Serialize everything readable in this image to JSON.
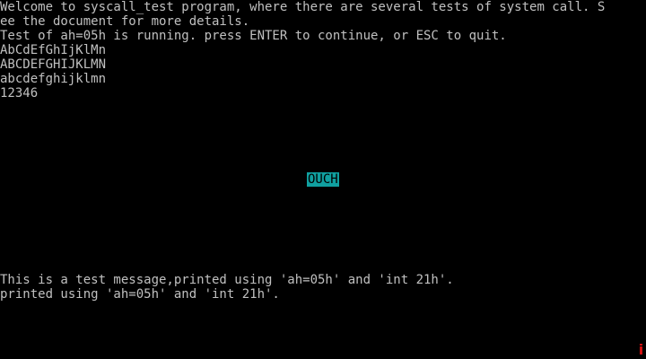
{
  "console": {
    "lines": [
      "Welcome to syscall_test program, where there are several tests of system call. S",
      "ee the document for more details.",
      "Test of ah=05h is running. press ENTER to continue, or ESC to quit.",
      "AbCdEfGhIjKlMn",
      "ABCDEFGHIJKLMN",
      "abcdefghijklmn",
      "12346"
    ],
    "message_lines": [
      "This is a test message,printed using 'ah=05h' and 'int 21h'.",
      "printed using 'ah=05h' and 'int 21h'."
    ]
  },
  "banner": {
    "text": "OUCH",
    "background": "#10a0a0",
    "foreground": "#000000"
  },
  "colors": {
    "background": "#000000",
    "text": "#c0c0c0",
    "cursor": "#d01010"
  }
}
